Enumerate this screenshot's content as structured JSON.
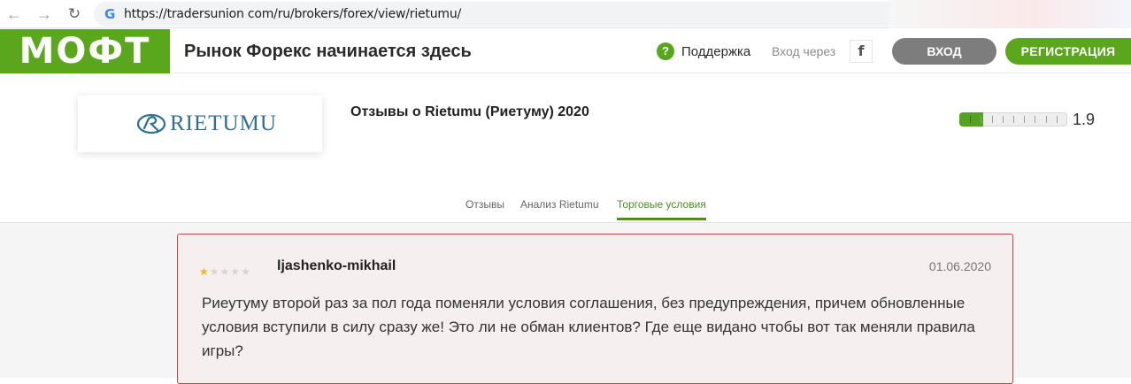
{
  "browser": {
    "url": "https://tradersunion com/ru/brokers/forex/view/rietumu/",
    "back_icon": "arrow-left-icon",
    "forward_icon": "arrow-right-icon",
    "reload_icon": "reload-icon"
  },
  "header": {
    "logo_text": "МОФТ",
    "tagline": "Рынок Форекс начинается здесь",
    "support_label": "Поддержка",
    "login_via": "Вход через",
    "facebook_label": "f",
    "login_button": "ВХОД",
    "register_button": "РЕГИСТРАЦИЯ"
  },
  "broker": {
    "logo_text": "RIETUMU",
    "title": "Отзывы о Rietumu (Риетуму) 2020",
    "rating": "1.9",
    "rating_value": 1.9,
    "rating_max": 10
  },
  "tabs": [
    {
      "label": "Отзывы",
      "active": false
    },
    {
      "label": "Анализ Rietumu",
      "active": false
    },
    {
      "label": "Торговые условия",
      "active": true
    }
  ],
  "review": {
    "author": "ljashenko-mikhail",
    "date": "01.06.2020",
    "stars_filled": 1,
    "stars_total": 5,
    "text": "Риеутуму второй раз за пол года поменяли условия соглашения, без предупреждения, причем обновленные условия вступили в силу сразу же! Это ли не обман клиентов? Где еще видано чтобы вот так меняли правила игры?"
  },
  "colors": {
    "brand_green": "#5aa71d",
    "active_tab": "#4d8f1f",
    "card_border": "#c94444",
    "login_gray": "#7d7d7d"
  }
}
